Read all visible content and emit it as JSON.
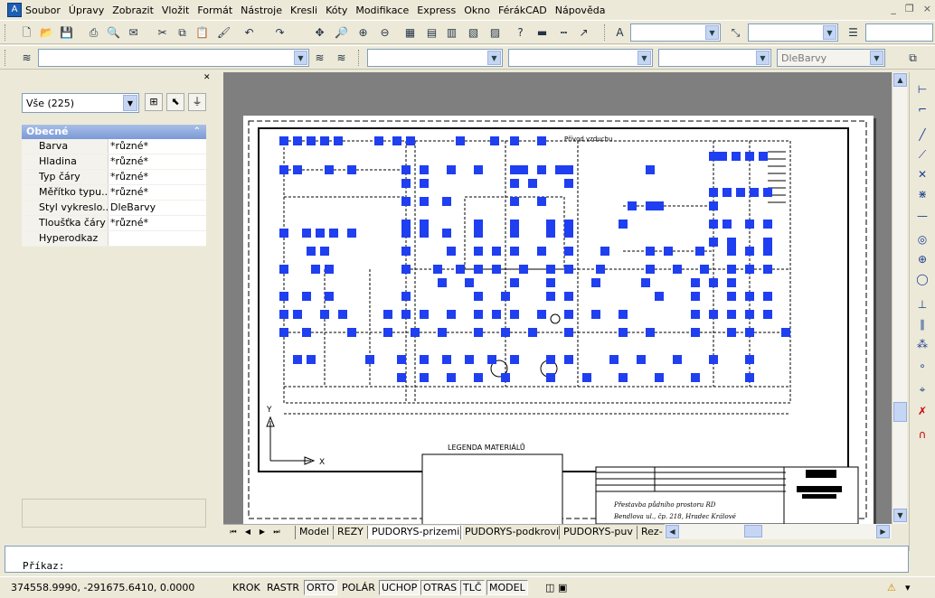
{
  "menubar": {
    "items": [
      "Soubor",
      "Úpravy",
      "Zobrazit",
      "Vložit",
      "Formát",
      "Nástroje",
      "Kresli",
      "Kóty",
      "Modifikace",
      "Express",
      "Okno",
      "FérákCAD",
      "Nápověda"
    ]
  },
  "toolbar_styles": {
    "textstyle_value": "",
    "dimstyle_value": "",
    "tablestyle_value": ""
  },
  "toolbar_layers": {
    "layer_value": "",
    "color_value": "",
    "linetype_value": "",
    "lineweight_value": "",
    "plotstyle_value": "DleBarvy"
  },
  "properties_palette": {
    "selection": "Vše (225)",
    "category": "Obecné",
    "rows": [
      {
        "key": "Barva",
        "value": "*různé*"
      },
      {
        "key": "Hladina",
        "value": "*různé*"
      },
      {
        "key": "Typ čáry",
        "value": "*různé*"
      },
      {
        "key": "Měřítko typu...",
        "value": "*různé*"
      },
      {
        "key": "Styl vykreslo...",
        "value": "DleBarvy"
      },
      {
        "key": "Tloušťka čáry",
        "value": "*různé*"
      },
      {
        "key": "Hyperodkaz",
        "value": ""
      }
    ]
  },
  "drawing": {
    "label_top": "Přívod vzduchu",
    "legend_title": "LEGENDA MATERIÁLŮ",
    "axis_y": "Y",
    "axis_x": "X",
    "title_block_line1": "Přestavba půdního prostoru RD",
    "title_block_line2": "Bendlova ul., čp. 218, Hradec Králové",
    "grip_color": "#1f3ff0"
  },
  "layout_tabs": [
    "Model",
    "REZY",
    "PUDORYS-prizemi",
    "PUDORYS-podkrovi",
    "PUDORYS-puv",
    "Rez-"
  ],
  "active_tab": "PUDORYS-prizemi",
  "command": {
    "prompt": "Příkaz:"
  },
  "statusbar": {
    "coords": "374558.9990, -291675.6410, 0.0000",
    "toggles": [
      {
        "label": "KROK",
        "on": false
      },
      {
        "label": "RASTR",
        "on": false
      },
      {
        "label": "ORTO",
        "on": true
      },
      {
        "label": "POLÁR",
        "on": false
      },
      {
        "label": "UCHOP",
        "on": true
      },
      {
        "label": "OTRAS",
        "on": true
      },
      {
        "label": "TLČ",
        "on": true
      },
      {
        "label": "MODEL",
        "on": true
      }
    ]
  }
}
